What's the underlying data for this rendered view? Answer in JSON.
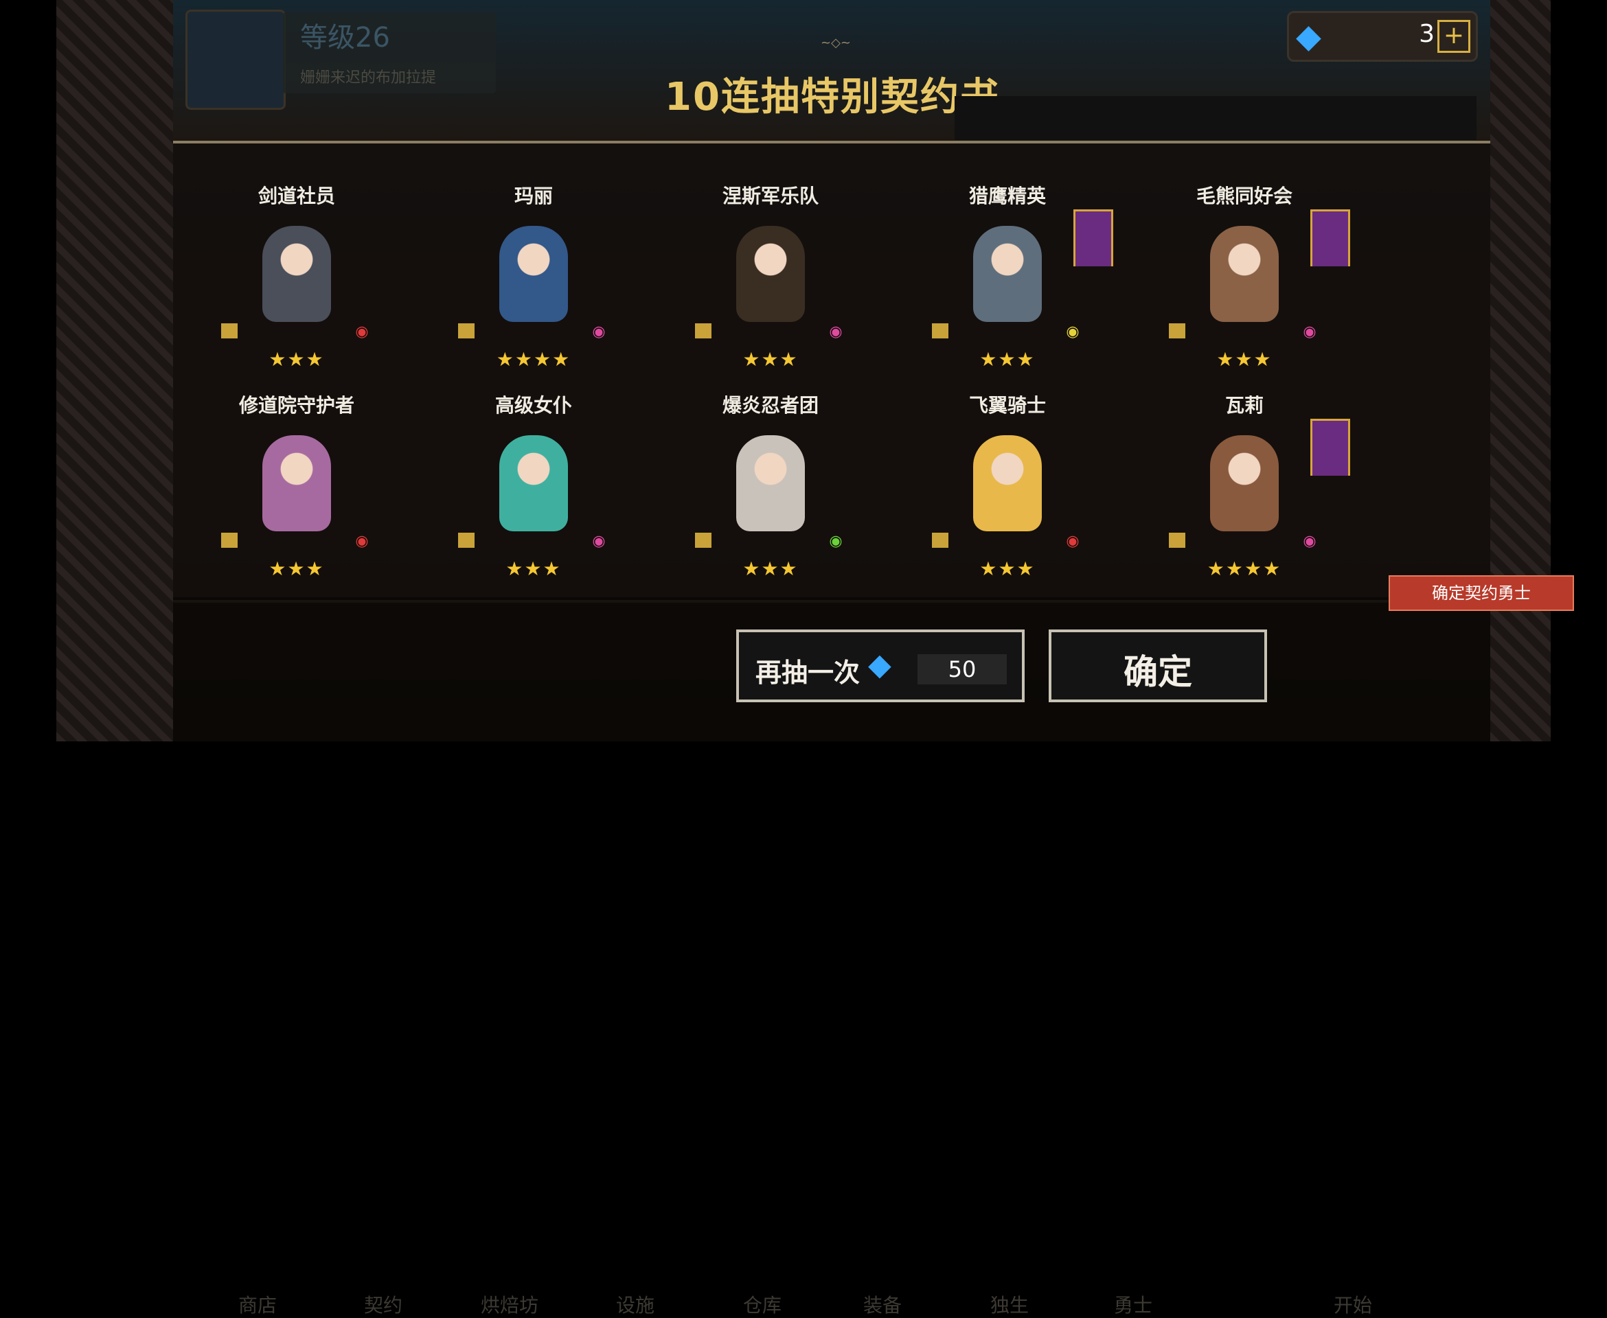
{
  "header": {
    "level_label": "等级26",
    "player_subtitle": "姗姗来迟的布加拉提",
    "gem_count": "3",
    "title": "10连抽特别契约书"
  },
  "heroes": [
    {
      "name": "剑道社员",
      "stars": "★★★",
      "color": "#4a4f5a",
      "elem_color": "#e03a3a"
    },
    {
      "name": "玛丽",
      "stars": "★★★★",
      "color": "#33588a",
      "elem_color": "#e04aa0"
    },
    {
      "name": "涅斯军乐队",
      "stars": "★★★",
      "color": "#3a2e22",
      "elem_color": "#e04aa0"
    },
    {
      "name": "猎鹰精英",
      "stars": "★★★",
      "color": "#5f6e7c",
      "elem_color": "#e6d23a"
    },
    {
      "name": "毛熊同好会",
      "stars": "★★★",
      "color": "#8b6246",
      "elem_color": "#e04aa0"
    },
    {
      "name": "修道院守护者",
      "stars": "★★★",
      "color": "#a76aa0",
      "elem_color": "#e03a3a"
    },
    {
      "name": "高级女仆",
      "stars": "★★★",
      "color": "#3fb0a0",
      "elem_color": "#e04aa0"
    },
    {
      "name": "爆炎忍者团",
      "stars": "★★★",
      "color": "#c9c2ba",
      "elem_color": "#6ad23a"
    },
    {
      "name": "飞翼骑士",
      "stars": "★★★",
      "color": "#e8b84a",
      "elem_color": "#e03a3a"
    },
    {
      "name": "瓦莉",
      "stars": "★★★★",
      "color": "#8a5a3e",
      "elem_color": "#e04aa0"
    }
  ],
  "bottom_nav": [
    "商店",
    "契约",
    "烘焙坊",
    "设施",
    "仓库",
    "装备",
    "独生",
    "勇士",
    "开始"
  ],
  "actions": {
    "draw_again_label": "再抽一次",
    "draw_cost": "50",
    "confirm_label": "确定",
    "confirm_hero_ribbon": "确定契约勇士"
  }
}
